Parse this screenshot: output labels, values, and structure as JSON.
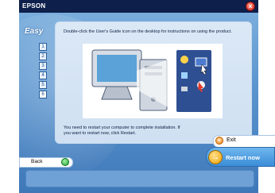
{
  "window": {
    "brand": "EPSON",
    "close_icon": "close-icon",
    "side_label": "Easy"
  },
  "steps": [
    {
      "label": "1"
    },
    {
      "label": "2"
    },
    {
      "label": "3"
    },
    {
      "label": "4"
    },
    {
      "label": "5"
    },
    {
      "label": "6"
    }
  ],
  "panel": {
    "instruction": "Double-click the User's Guide icon on the desktop for instructions on using the product.",
    "restart_note": "You need to restart your computer to complete installation. If you want to restart now, click Restart."
  },
  "buttons": {
    "exit_label": "Exit",
    "restart_label": "Restart now",
    "back_label": "Back"
  },
  "colors": {
    "titlebar": "#0d1f4a",
    "window_bg": "#5b95cf",
    "panel_bg": "#dbe8f6",
    "restart_bg": "#3a8dd7"
  }
}
